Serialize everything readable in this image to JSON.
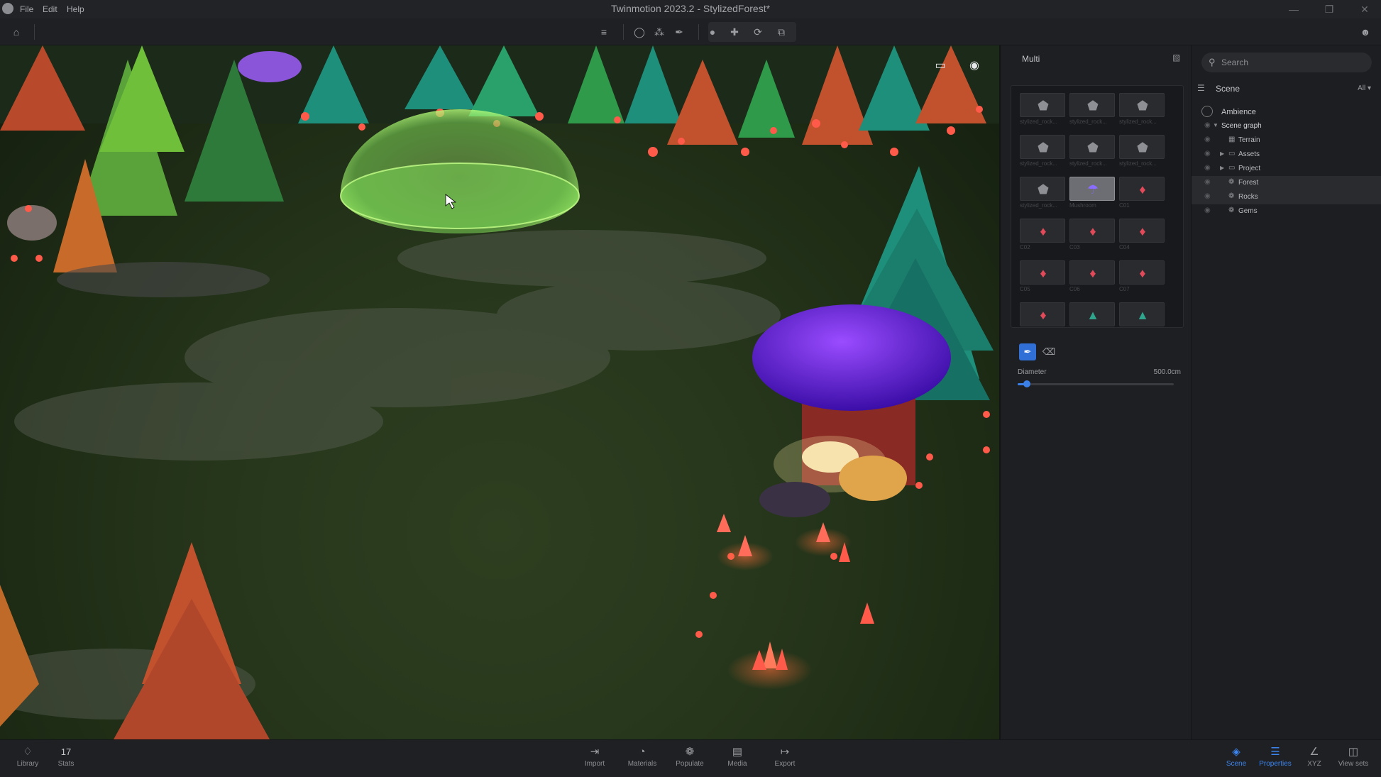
{
  "window": {
    "title": "Twinmotion 2023.2 - StylizedForest*",
    "menu": [
      "File",
      "Edit",
      "Help"
    ],
    "logo_icon": "twinmotion-logo-icon",
    "controls": [
      "minimize-icon",
      "restore-icon",
      "close-icon"
    ]
  },
  "toolbar": {
    "left_icons": [
      "home-icon"
    ],
    "center_icons": [
      "layers-icon",
      "circle-brush-icon",
      "scatter-icon",
      "eyedropper-icon"
    ],
    "transform_icons": [
      "select-icon",
      "move-icon",
      "rotate-icon",
      "scale-icon"
    ],
    "right_icons": [
      "user-icon"
    ]
  },
  "viewport": {
    "icons": [
      "panel-toggle-icon",
      "eye-icon"
    ]
  },
  "properties": {
    "header": "Multi",
    "lock_icon": "lock-icon",
    "assets": [
      {
        "label": "stylized_rock...",
        "kind": "rock",
        "selected": false
      },
      {
        "label": "stylized_rock...",
        "kind": "rock",
        "selected": false
      },
      {
        "label": "stylized_rock...",
        "kind": "rock",
        "selected": false
      },
      {
        "label": "stylized_rock...",
        "kind": "rock",
        "selected": false
      },
      {
        "label": "stylized_rock...",
        "kind": "rock",
        "selected": false
      },
      {
        "label": "stylized_rock...",
        "kind": "rock",
        "selected": false
      },
      {
        "label": "stylized_rock...",
        "kind": "rock",
        "selected": false
      },
      {
        "label": "Mushroom",
        "kind": "mushroom",
        "selected": true
      },
      {
        "label": "C01",
        "kind": "crystal",
        "selected": false
      },
      {
        "label": "C02",
        "kind": "crystal",
        "selected": false
      },
      {
        "label": "C03",
        "kind": "crystal",
        "selected": false
      },
      {
        "label": "C04",
        "kind": "crystal",
        "selected": false
      },
      {
        "label": "C05",
        "kind": "crystal",
        "selected": false
      },
      {
        "label": "C06",
        "kind": "crystal",
        "selected": false
      },
      {
        "label": "C07",
        "kind": "crystal",
        "selected": false
      },
      {
        "label": "",
        "kind": "crystal",
        "selected": false
      },
      {
        "label": "",
        "kind": "tree",
        "selected": false
      },
      {
        "label": "",
        "kind": "tree",
        "selected": false
      }
    ],
    "tools": {
      "paint_icon": "paint-brush-icon",
      "erase_icon": "eraser-icon"
    },
    "diameter": {
      "label": "Diameter",
      "value": "500.0cm",
      "fraction": 0.06
    }
  },
  "scene": {
    "search": {
      "placeholder": "Search"
    },
    "title": "Scene",
    "filter": "All",
    "ambience": "Ambience",
    "tree": [
      {
        "label": "Scene graph",
        "level": 0,
        "caret": "down",
        "icon": "none",
        "highlight": false
      },
      {
        "label": "Terrain",
        "level": 1,
        "caret": "none",
        "icon": "terrain-icon",
        "highlight": false
      },
      {
        "label": "Assets",
        "level": 1,
        "caret": "right",
        "icon": "folder-icon",
        "highlight": false
      },
      {
        "label": "Project",
        "level": 1,
        "caret": "right",
        "icon": "folder-icon",
        "highlight": false
      },
      {
        "label": "Forest",
        "level": 1,
        "caret": "none",
        "icon": "scatter-icon",
        "highlight": true
      },
      {
        "label": "Rocks",
        "level": 1,
        "caret": "none",
        "icon": "scatter-icon",
        "highlight": true
      },
      {
        "label": "Gems",
        "level": 1,
        "caret": "none",
        "icon": "scatter-icon",
        "highlight": false
      }
    ]
  },
  "bottombar": {
    "left": [
      {
        "label": "Library",
        "icon": "library-icon"
      },
      {
        "label": "Stats",
        "value": "17"
      }
    ],
    "center": [
      {
        "label": "Import",
        "icon": "import-icon"
      },
      {
        "label": "Materials",
        "icon": "materials-icon"
      },
      {
        "label": "Populate",
        "icon": "populate-icon"
      },
      {
        "label": "Media",
        "icon": "media-icon"
      },
      {
        "label": "Export",
        "icon": "export-icon"
      }
    ],
    "right": [
      {
        "label": "Scene",
        "icon": "scene-icon",
        "active": true
      },
      {
        "label": "Properties",
        "icon": "properties-icon",
        "active": true
      },
      {
        "label": "XYZ",
        "icon": "xyz-icon",
        "active": false
      },
      {
        "label": "View sets",
        "icon": "view-sets-icon",
        "active": false
      }
    ]
  },
  "colors": {
    "accent": "#3c86f0",
    "grass": "#26361b",
    "brush_sphere": "#7ed957",
    "crystal": "#ff5a4a",
    "mushroom_cap": "#6a2ad0",
    "tree_teal": "#1e8f7a",
    "tree_orange": "#c2512d"
  }
}
